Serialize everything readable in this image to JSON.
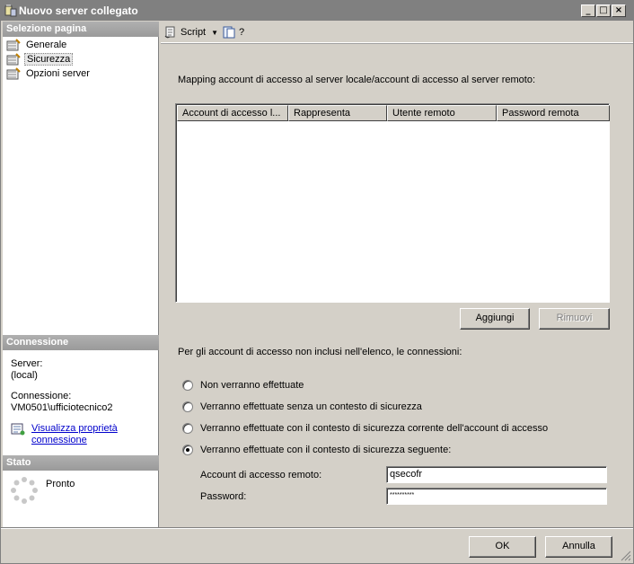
{
  "window": {
    "title": "Nuovo server collegato",
    "min_label": "_",
    "max_label": "□",
    "close_label": "×"
  },
  "sidebar": {
    "pages_header": "Selezione pagina",
    "pages": [
      {
        "label": "Generale"
      },
      {
        "label": "Sicurezza",
        "selected": true
      },
      {
        "label": "Opzioni server"
      }
    ],
    "connection_header": "Connessione",
    "server_label": "Server:",
    "server_value": "(local)",
    "connection_label": "Connessione:",
    "connection_value": "VM0501\\ufficiotecnico2",
    "view_props_link_line1": "Visualizza proprietà",
    "view_props_link_line2": "connessione",
    "status_header": "Stato",
    "status_value": "Pronto"
  },
  "toolbar": {
    "script_label": "Script",
    "help_label": "?"
  },
  "main": {
    "mapping_label": "Mapping account di accesso al server locale/account di accesso al server remoto:",
    "columns": [
      "Account di accesso l...",
      "Rappresenta",
      "Utente remoto",
      "Password remota"
    ],
    "add_button": "Aggiungi",
    "remove_button": "Rimuovi",
    "not_listed_label": "Per gli account di accesso non inclusi nell'elenco, le connessioni:",
    "options": [
      {
        "label": "Non verranno effettuate",
        "checked": false
      },
      {
        "label": "Verranno effettuate senza un contesto di sicurezza",
        "checked": false
      },
      {
        "label": "Verranno effettuate con il contesto di sicurezza corrente dell'account di accesso",
        "checked": false
      },
      {
        "label": "Verranno effettuate con il contesto di sicurezza seguente:",
        "checked": true
      }
    ],
    "remote_login_label": "Account di accesso remoto:",
    "remote_login_value": "qsecofr",
    "password_label": "Password:",
    "password_value": "**********"
  },
  "footer": {
    "ok_button": "OK",
    "cancel_button": "Annulla"
  },
  "colors": {
    "titlebar": "#808080",
    "section_header": "#a5a5a5",
    "face": "#d4d0c8",
    "link": "#0000cc"
  }
}
